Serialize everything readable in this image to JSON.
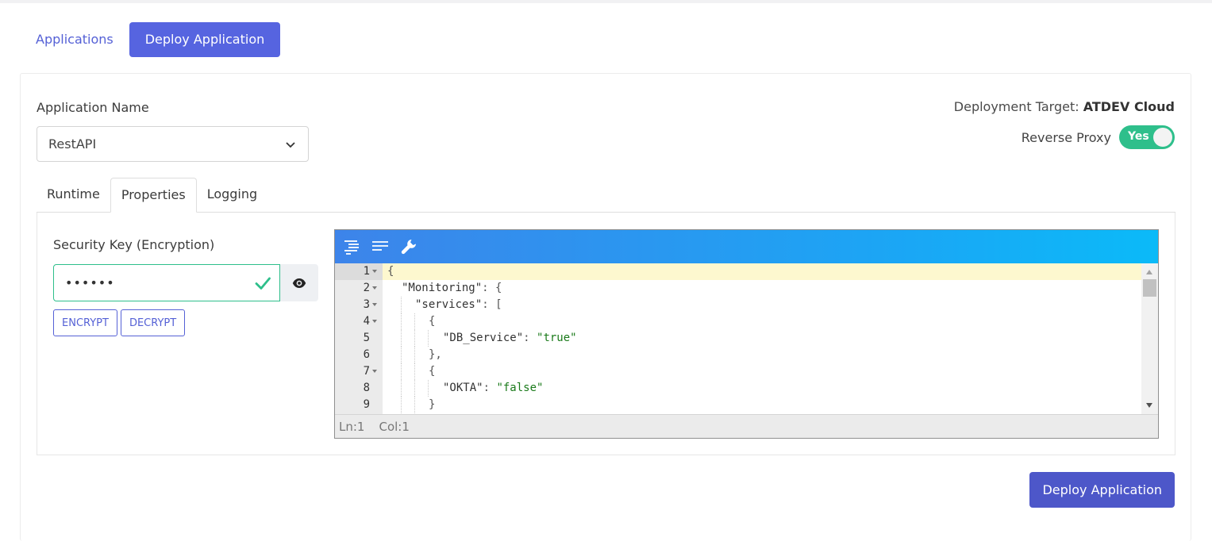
{
  "nav": {
    "applications_label": "Applications",
    "deploy_label": "Deploy Application"
  },
  "form": {
    "app_name_label": "Application Name",
    "app_name_value": "RestAPI",
    "deployment_target_label": "Deployment Target:",
    "deployment_target_value": "ATDEV Cloud",
    "reverse_proxy_label": "Reverse Proxy",
    "reverse_proxy_value": "Yes"
  },
  "tabs": [
    {
      "label": "Runtime"
    },
    {
      "label": "Properties"
    },
    {
      "label": "Logging"
    }
  ],
  "properties": {
    "security_key_label": "Security Key (Encryption)",
    "security_key_masked": "••••••",
    "encrypt_label": "ENCRYPT",
    "decrypt_label": "DECRYPT"
  },
  "editor": {
    "lines": [
      {
        "n": "1",
        "fold": true
      },
      {
        "n": "2",
        "fold": true
      },
      {
        "n": "3",
        "fold": true
      },
      {
        "n": "4",
        "fold": true
      },
      {
        "n": "5",
        "fold": false
      },
      {
        "n": "6",
        "fold": false
      },
      {
        "n": "7",
        "fold": true
      },
      {
        "n": "8",
        "fold": false
      },
      {
        "n": "9",
        "fold": false
      }
    ],
    "code": {
      "l1": "{",
      "l2_key": "\"Monitoring\"",
      "l2_rest": ": {",
      "l3_key": "\"services\"",
      "l3_rest": ": [",
      "l4": "{",
      "l5_key": "\"DB_Service\"",
      "l5_sep": ": ",
      "l5_val": "\"true\"",
      "l6": "},",
      "l7": "{",
      "l8_key": "\"OKTA\"",
      "l8_sep": ": ",
      "l8_val": "\"false\"",
      "l9": "}"
    },
    "status_ln": "Ln:1",
    "status_col": "Col:1"
  },
  "footer": {
    "deploy_button_label": "Deploy Application"
  },
  "colors": {
    "accent": "#5664e0",
    "toggle_on": "#2ebf8b",
    "string_value": "#1a7a1a"
  }
}
